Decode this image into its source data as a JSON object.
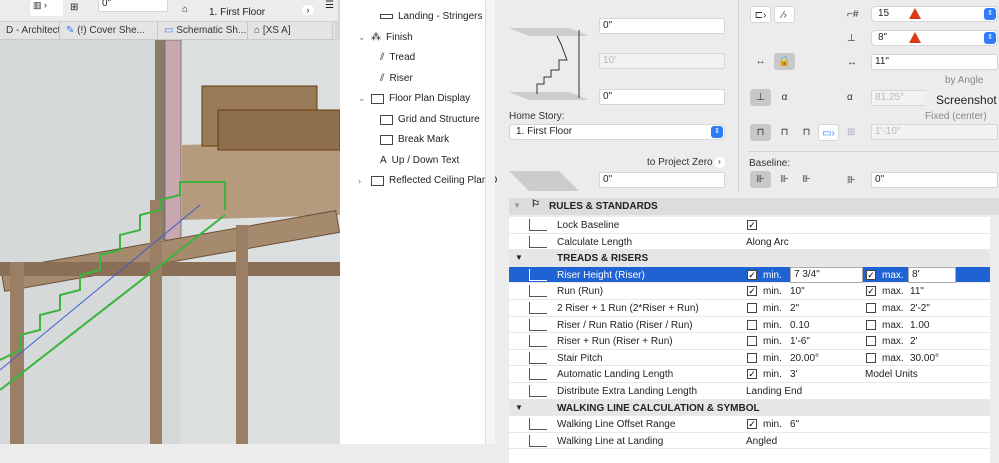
{
  "toolbar": {
    "offset_value": "0\"",
    "story": "1. First Floor"
  },
  "view_tabs": [
    "D - Architect...",
    "(!) Cover She...",
    "Schematic Sh...",
    "[XS A]"
  ],
  "tree": {
    "items": [
      {
        "label": "Landing - Stringers",
        "level": 2
      },
      {
        "label": "Finish",
        "level": 1,
        "expanded": true
      },
      {
        "label": "Tread",
        "level": 2
      },
      {
        "label": "Riser",
        "level": 2
      },
      {
        "label": "Floor Plan Display",
        "level": 1,
        "expanded": true
      },
      {
        "label": "Grid and Structure",
        "level": 2
      },
      {
        "label": "Break Mark",
        "level": 2
      },
      {
        "label": "Up / Down Text",
        "level": 2
      },
      {
        "label": "Reflected Ceiling Plan D",
        "level": 1,
        "expanded": false
      }
    ]
  },
  "geometry": {
    "top_offset": "0\"",
    "height": "10'",
    "bottom_offset": "0\"",
    "home_story_label": "Home Story:",
    "home_story": "1. First Floor",
    "to_project_zero": "to Project Zero",
    "project_zero_value": "0\"",
    "num_risers": "15",
    "riser_height": "8\"",
    "tread_depth": "11\"",
    "by_angle": "by Angle",
    "angle": "81.25°",
    "screenshot_tooltip": "Screenshot",
    "fixed_center": "Fixed (center)",
    "width": "1'-10\"",
    "baseline_label": "Baseline:",
    "baseline_offset": "0\""
  },
  "rules": {
    "section_title": "RULES & STANDARDS",
    "lock_baseline": {
      "label": "Lock Baseline",
      "checked": true
    },
    "calculate_length": {
      "label": "Calculate Length",
      "value": "Along Arc"
    },
    "treads_header": "TREADS & RISERS",
    "min_label": "min.",
    "max_label": "max.",
    "rows": [
      {
        "label": "Riser Height (Riser)",
        "min_on": true,
        "min": "7 3/4\"",
        "max_on": true,
        "max": "8'"
      },
      {
        "label": "Run (Run)",
        "min_on": true,
        "min": "10\"",
        "max_on": true,
        "max": "11\""
      },
      {
        "label": "2 Riser + 1 Run (2*Riser + Run)",
        "min_on": false,
        "min": "2\"",
        "max_on": false,
        "max": "2'-2\""
      },
      {
        "label": "Riser / Run Ratio (Riser / Run)",
        "min_on": false,
        "min": "0.10",
        "max_on": false,
        "max": "1.00"
      },
      {
        "label": "Riser + Run (Riser + Run)",
        "min_on": false,
        "min": "1'-6\"",
        "max_on": false,
        "max": "2'"
      },
      {
        "label": "Stair Pitch",
        "min_on": false,
        "min": "20.00°",
        "max_on": false,
        "max": "30.00°"
      }
    ],
    "auto_landing": {
      "label": "Automatic Landing Length",
      "min_on": true,
      "min": "3'",
      "units": "Model Units"
    },
    "distribute": {
      "label": "Distribute Extra Landing Length",
      "value": "Landing End"
    },
    "walking_header": "WALKING LINE CALCULATION & SYMBOL",
    "walking_offset": {
      "label": "Walking Line Offset Range",
      "min_on": true,
      "min": "6\""
    },
    "walking_landing": {
      "label": "Walking Line at Landing",
      "value": "Angled"
    }
  },
  "colors": {
    "selection": "#1f62d3",
    "warning": "#d93a1a",
    "accent": "#2f7cf6"
  }
}
